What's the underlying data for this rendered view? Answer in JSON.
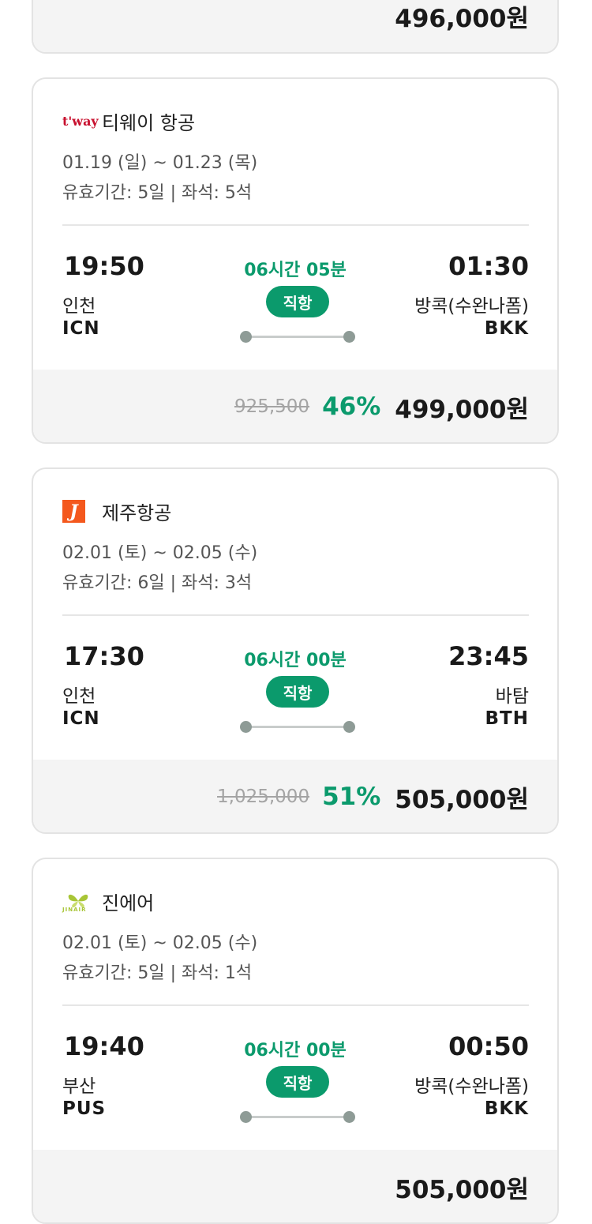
{
  "top_partial": {
    "final_price": "496,000원"
  },
  "cards": [
    {
      "airline": "티웨이 항공",
      "logo_text": "t'way",
      "dates": "01.19 (일) ~ 01.23 (목)",
      "validity": "유효기간: 5일 | 좌석: 5석",
      "dep_time": "19:50",
      "dep_city": "인천",
      "dep_code": "ICN",
      "duration": "06시간 05분",
      "direct_label": "직항",
      "arr_time": "01:30",
      "arr_city": "방콕(수완나폼)",
      "arr_code": "BKK",
      "orig_price": "925,500",
      "discount": "46%",
      "final_price": "499,000원"
    },
    {
      "airline": "제주항공",
      "logo_text": "J",
      "dates": "02.01 (토) ~ 02.05 (수)",
      "validity": "유효기간: 6일 | 좌석: 3석",
      "dep_time": "17:30",
      "dep_city": "인천",
      "dep_code": "ICN",
      "duration": "06시간 00분",
      "direct_label": "직항",
      "arr_time": "23:45",
      "arr_city": "바탐",
      "arr_code": "BTH",
      "orig_price": "1,025,000",
      "discount": "51%",
      "final_price": "505,000원"
    },
    {
      "airline": "진에어",
      "logo_text": "JINAIR",
      "dates": "02.01 (토) ~ 02.05 (수)",
      "validity": "유효기간: 5일 | 좌석: 1석",
      "dep_time": "19:40",
      "dep_city": "부산",
      "dep_code": "PUS",
      "duration": "06시간 00분",
      "direct_label": "직항",
      "arr_time": "00:50",
      "arr_city": "방콕(수완나폼)",
      "arr_code": "BKK",
      "final_price": "505,000원"
    }
  ],
  "colors": {
    "accent": "#0b9a6c",
    "twayRed": "#c8102e",
    "jejuOrange": "#f4581d",
    "jinairGreen": "#a8c536"
  }
}
